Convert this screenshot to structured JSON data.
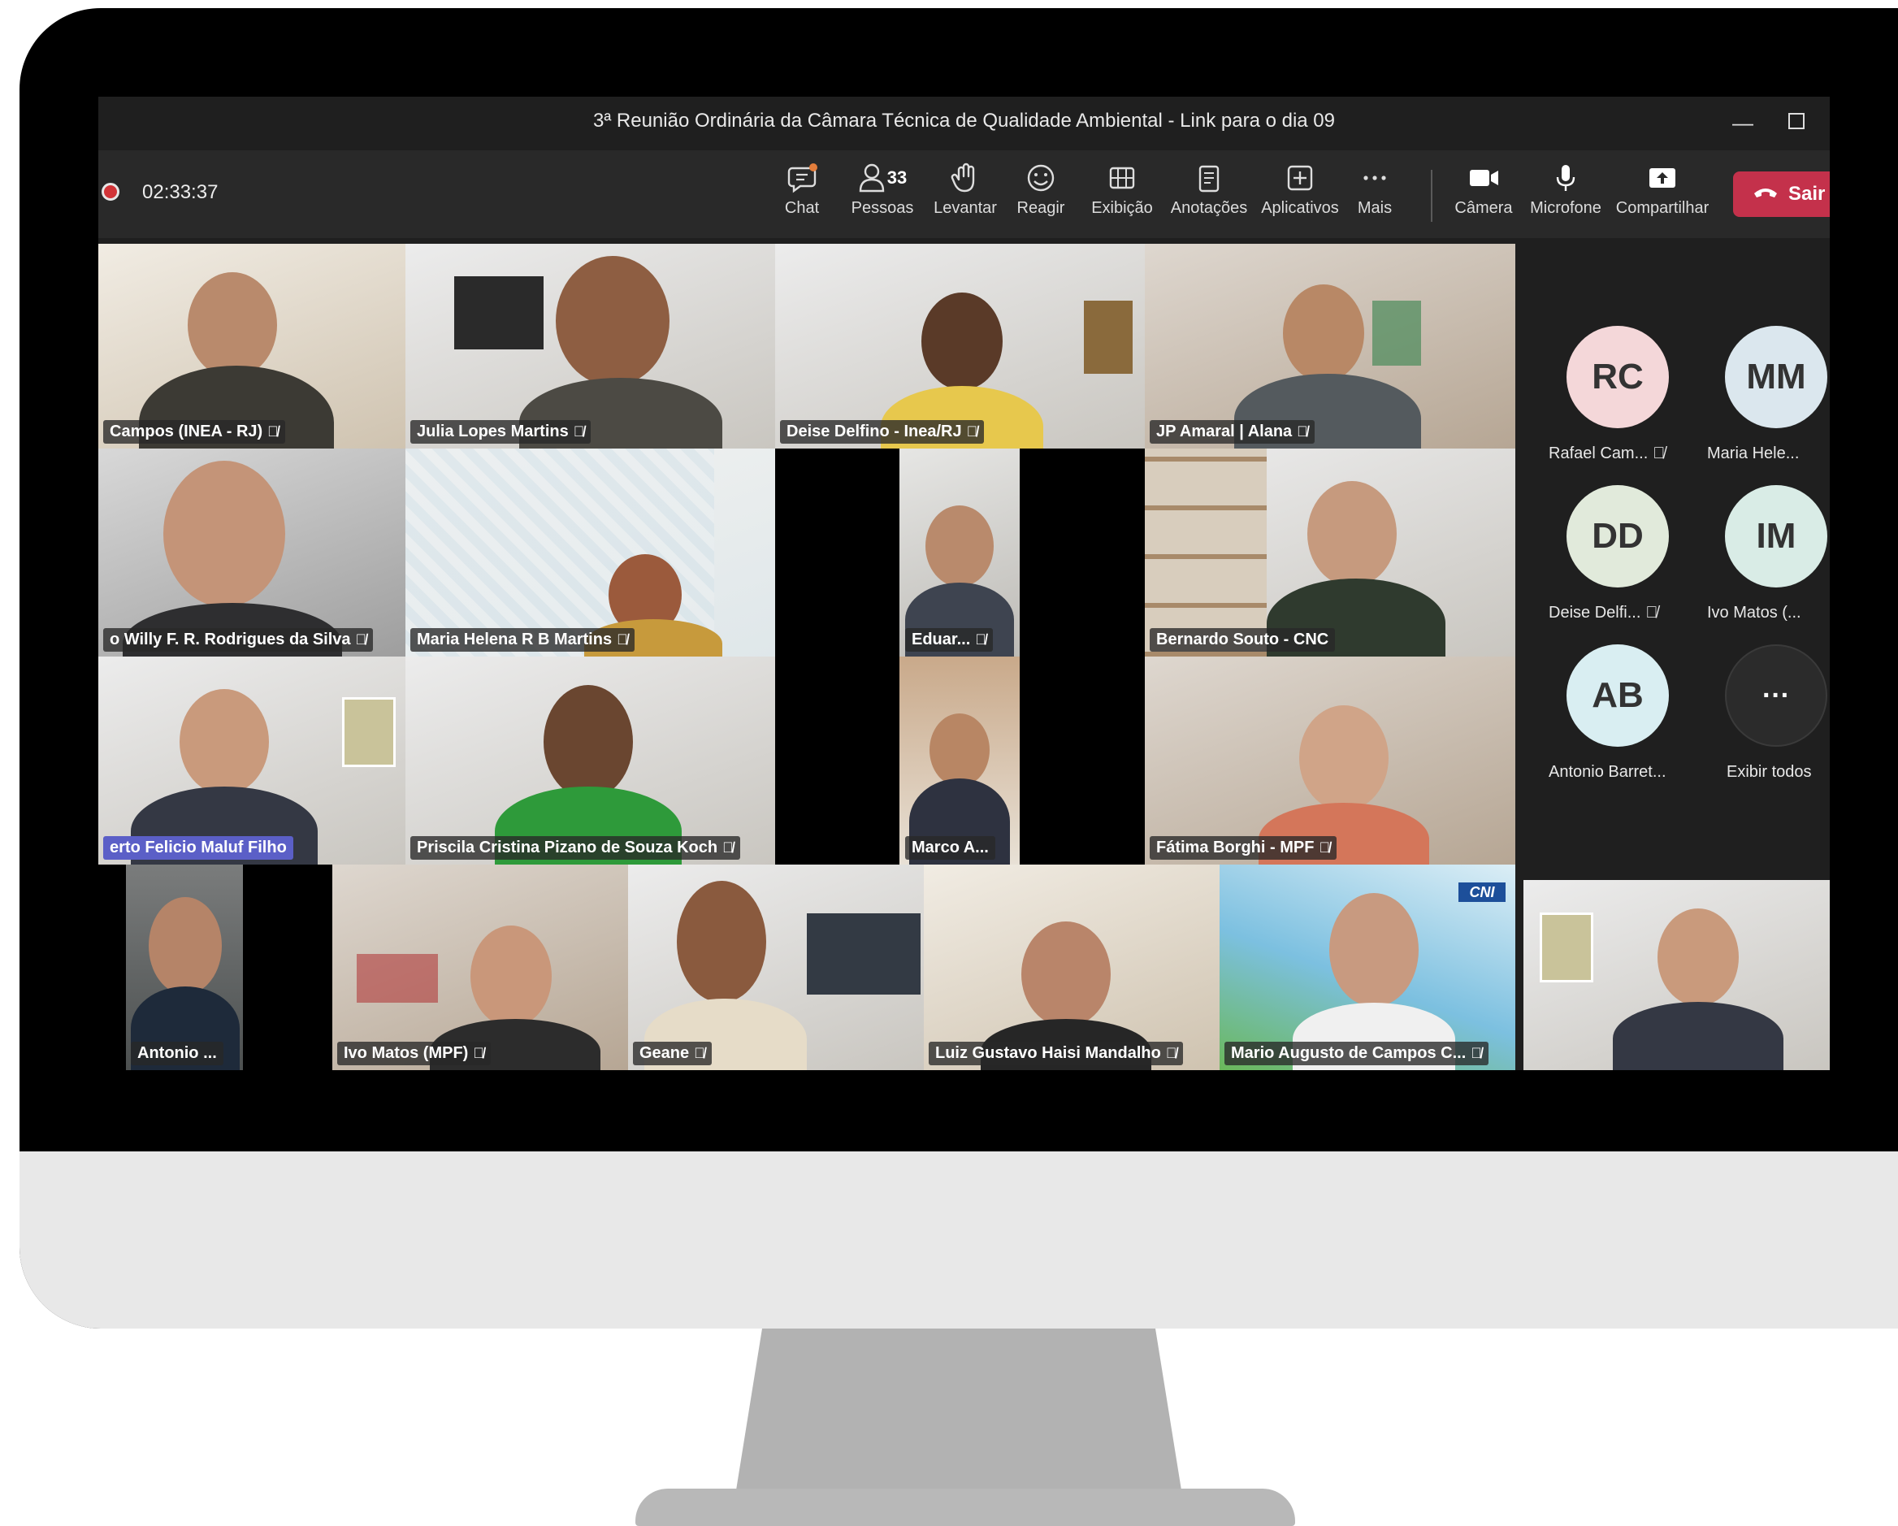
{
  "window": {
    "title": "3ª Reunião Ordinária da Câmara Técnica de Qualidade Ambiental - Link para o dia 09",
    "minimize_icon": "minimize-icon",
    "maximize_icon": "maximize-icon"
  },
  "toolbar": {
    "recording_time": "02:33:37",
    "participants_count": "33",
    "items": [
      {
        "label": "Chat",
        "icon": "chat-icon"
      },
      {
        "label": "Pessoas",
        "icon": "people-icon"
      },
      {
        "label": "Levantar",
        "icon": "raise-hand-icon"
      },
      {
        "label": "Reagir",
        "icon": "smiley-icon"
      },
      {
        "label": "Exibição",
        "icon": "grid-view-icon"
      },
      {
        "label": "Anotações",
        "icon": "notes-icon"
      },
      {
        "label": "Aplicativos",
        "icon": "apps-plus-icon"
      },
      {
        "label": "Mais",
        "icon": "more-icon"
      },
      {
        "label": "Câmera",
        "icon": "camera-icon"
      },
      {
        "label": "Microfone",
        "icon": "microphone-icon"
      },
      {
        "label": "Compartilhar",
        "icon": "share-screen-icon"
      }
    ],
    "leave_label": "Sair",
    "leave_color": "#c4314b"
  },
  "video_tiles": [
    {
      "name": "Campos (INEA - RJ)",
      "muted": true
    },
    {
      "name": "Julia Lopes Martins",
      "muted": true
    },
    {
      "name": "Deise Delfino - Inea/RJ",
      "muted": true
    },
    {
      "name": "JP Amaral | Alana",
      "muted": true
    },
    {
      "name": "o Willy F. R. Rodrigues da Silva",
      "muted": true
    },
    {
      "name": "Maria Helena R B Martins",
      "muted": true
    },
    {
      "name": "Eduar...",
      "muted": true
    },
    {
      "name": "Bernardo Souto - CNC",
      "muted": false
    },
    {
      "name": "erto Felicio Maluf Filho",
      "muted": false,
      "highlighted": true
    },
    {
      "name": "Priscila Cristina Pizano de Souza Koch",
      "muted": true
    },
    {
      "name": "Marco A...",
      "muted": false
    },
    {
      "name": "Fátima Borghi - MPF",
      "muted": true
    },
    {
      "name": "Antonio ...",
      "muted": false
    },
    {
      "name": "Ivo Matos (MPF)",
      "muted": true
    },
    {
      "name": "Geane",
      "muted": true
    },
    {
      "name": "Luiz Gustavo Haisi Mandalho",
      "muted": true
    },
    {
      "name": "Mario Augusto de Campos C...",
      "muted": true
    },
    {
      "name": "",
      "muted": false
    }
  ],
  "cni_badge": "CNI",
  "roster": {
    "people": [
      {
        "initials": "RC",
        "name": "Rafael Cam...",
        "color": "#f4d7d9"
      },
      {
        "initials": "MM",
        "name": "Maria Hele...",
        "color": "#dbe7ee"
      },
      {
        "initials": "DD",
        "name": "Deise Delfi...",
        "color": "#e1eadb"
      },
      {
        "initials": "IM",
        "name": "Ivo Matos (...",
        "color": "#d9ece6"
      },
      {
        "initials": "AB",
        "name": "Antonio Barret...",
        "color": "#d9eef2"
      }
    ],
    "view_all_label": "Exibir todos",
    "view_all_symbol": "···"
  },
  "accent_colors": {
    "recording": "#d13438",
    "highlight_label": "#5b5fc7"
  }
}
